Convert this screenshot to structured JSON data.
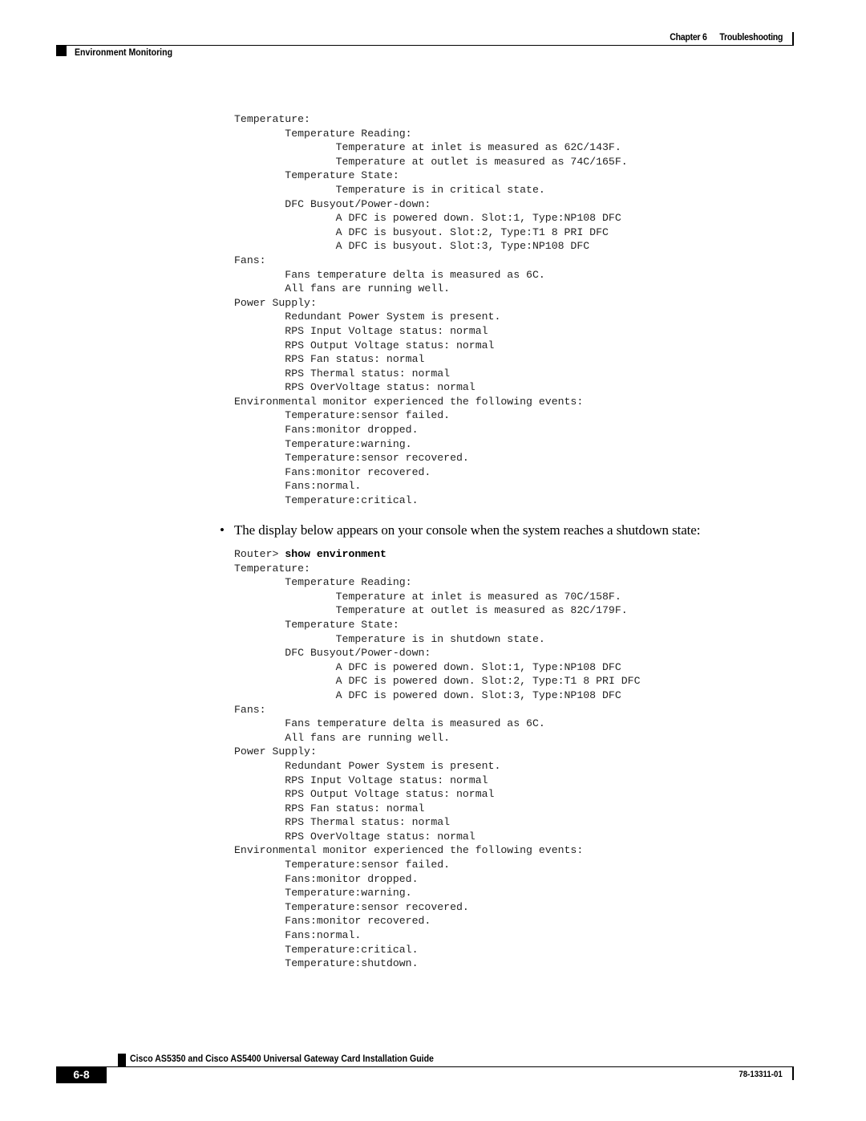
{
  "header": {
    "chapter": "Chapter 6",
    "chapter_title": "Troubleshooting",
    "section": "Environment Monitoring"
  },
  "code_block_1": {
    "lines": [
      "Temperature:",
      "        Temperature Reading:",
      "                Temperature at inlet is measured as 62C/143F.",
      "                Temperature at outlet is measured as 74C/165F.",
      "        Temperature State:",
      "                Temperature is in critical state.",
      "        DFC Busyout/Power-down:",
      "                A DFC is powered down. Slot:1, Type:NP108 DFC",
      "                A DFC is busyout. Slot:2, Type:T1 8 PRI DFC",
      "                A DFC is busyout. Slot:3, Type:NP108 DFC",
      "Fans:",
      "        Fans temperature delta is measured as 6C.",
      "        All fans are running well.",
      "Power Supply:",
      "        Redundant Power System is present.",
      "        RPS Input Voltage status: normal",
      "        RPS Output Voltage status: normal",
      "        RPS Fan status: normal",
      "        RPS Thermal status: normal",
      "        RPS OverVoltage status: normal",
      "Environmental monitor experienced the following events:",
      "        Temperature:sensor failed.",
      "        Fans:monitor dropped.",
      "        Temperature:warning.",
      "        Temperature:sensor recovered.",
      "        Fans:monitor recovered.",
      "        Fans:normal.",
      "        Temperature:critical."
    ]
  },
  "bullet": {
    "symbol": "•",
    "text": "The display below appears on your console when the system reaches a shutdown state:"
  },
  "code_block_2": {
    "prompt": "Router> ",
    "command": "show environment",
    "lines": [
      "Temperature:",
      "        Temperature Reading:",
      "                Temperature at inlet is measured as 70C/158F.",
      "                Temperature at outlet is measured as 82C/179F.",
      "        Temperature State:",
      "                Temperature is in shutdown state.",
      "        DFC Busyout/Power-down:",
      "                A DFC is powered down. Slot:1, Type:NP108 DFC",
      "                A DFC is powered down. Slot:2, Type:T1 8 PRI DFC",
      "                A DFC is powered down. Slot:3, Type:NP108 DFC",
      "Fans:",
      "        Fans temperature delta is measured as 6C.",
      "        All fans are running well.",
      "Power Supply:",
      "        Redundant Power System is present.",
      "        RPS Input Voltage status: normal",
      "        RPS Output Voltage status: normal",
      "        RPS Fan status: normal",
      "        RPS Thermal status: normal",
      "        RPS OverVoltage status: normal",
      "Environmental monitor experienced the following events:",
      "        Temperature:sensor failed.",
      "        Fans:monitor dropped.",
      "        Temperature:warning.",
      "        Temperature:sensor recovered.",
      "        Fans:monitor recovered.",
      "        Fans:normal.",
      "        Temperature:critical.",
      "        Temperature:shutdown."
    ]
  },
  "footer": {
    "book_title": "Cisco AS5350 and Cisco AS5400 Universal Gateway Card Installation Guide",
    "page_number": "6-8",
    "doc_number": "78-13311-01"
  }
}
